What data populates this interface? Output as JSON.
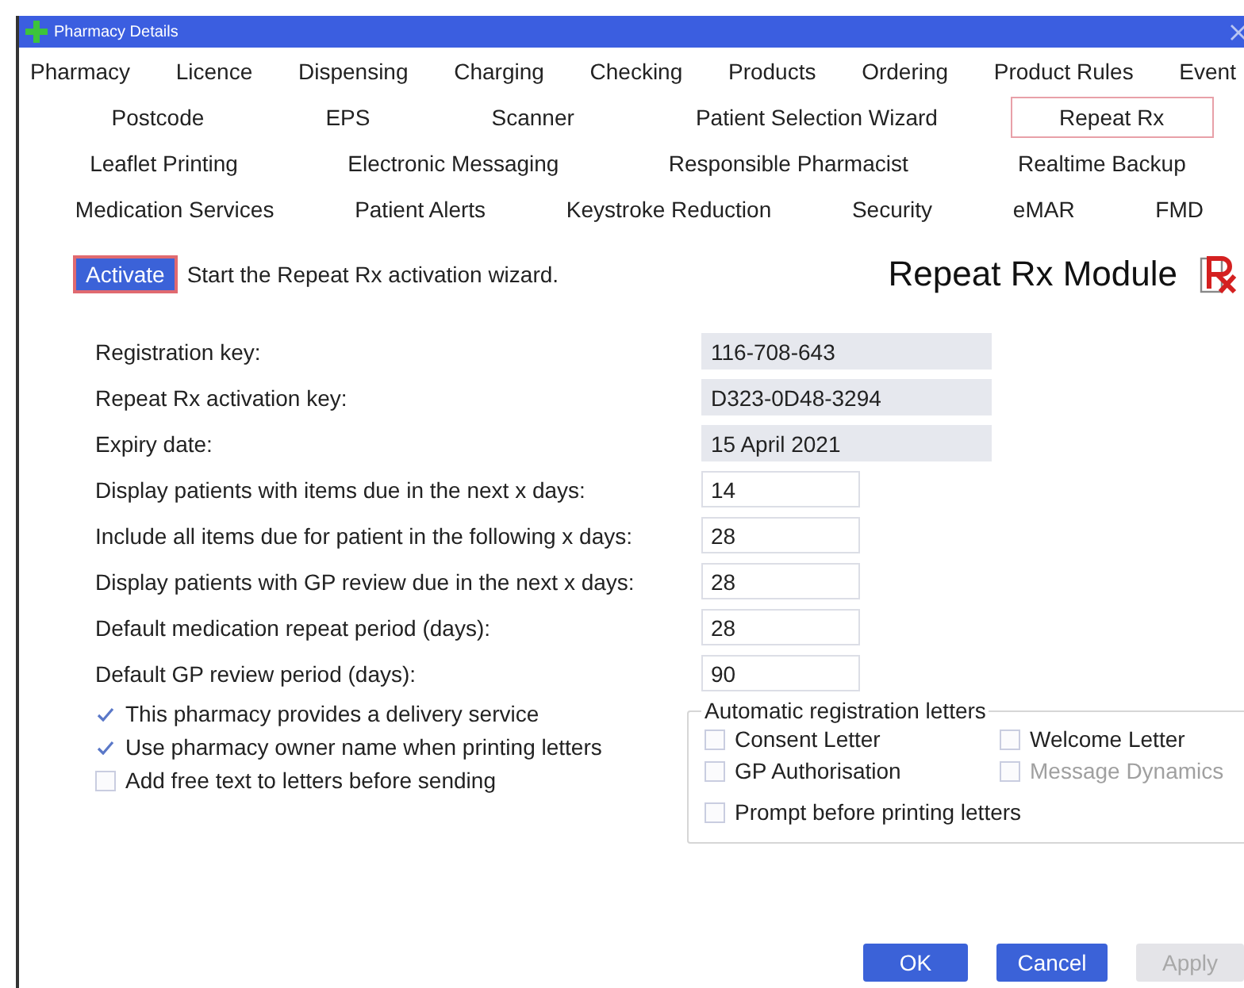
{
  "window": {
    "title": "Pharmacy Details"
  },
  "tab_rows": [
    [
      {
        "label": "Pharmacy",
        "selected": false
      },
      {
        "label": "Licence",
        "selected": false
      },
      {
        "label": "Dispensing",
        "selected": false
      },
      {
        "label": "Charging",
        "selected": false
      },
      {
        "label": "Checking",
        "selected": false
      },
      {
        "label": "Products",
        "selected": false
      },
      {
        "label": "Ordering",
        "selected": false
      },
      {
        "label": "Product Rules",
        "selected": false
      },
      {
        "label": "Event",
        "selected": false
      }
    ],
    [
      {
        "label": "Postcode",
        "selected": false
      },
      {
        "label": "EPS",
        "selected": false
      },
      {
        "label": "Scanner",
        "selected": false
      },
      {
        "label": "Patient Selection Wizard",
        "selected": false
      },
      {
        "label": "Repeat Rx",
        "selected": true
      }
    ],
    [
      {
        "label": "Leaflet Printing",
        "selected": false
      },
      {
        "label": "Electronic Messaging",
        "selected": false
      },
      {
        "label": "Responsible Pharmacist",
        "selected": false
      },
      {
        "label": "Realtime Backup",
        "selected": false
      }
    ],
    [
      {
        "label": "Medication Services",
        "selected": false
      },
      {
        "label": "Patient Alerts",
        "selected": false
      },
      {
        "label": "Keystroke Reduction",
        "selected": false
      },
      {
        "label": "Security",
        "selected": false
      },
      {
        "label": "eMAR",
        "selected": false
      },
      {
        "label": "FMD",
        "selected": false
      }
    ]
  ],
  "activate": {
    "button": "Activate",
    "description": "Start the Repeat Rx activation wizard."
  },
  "module_title": "Repeat Rx Module",
  "fields": [
    {
      "label": "Registration key:",
      "value": "116-708-643",
      "readonly": true
    },
    {
      "label": "Repeat Rx activation key:",
      "value": "D323-0D48-3294",
      "readonly": true
    },
    {
      "label": "Expiry date:",
      "value": "15 April 2021",
      "readonly": true
    },
    {
      "label": "Display patients with items due in the next x days:",
      "value": "14",
      "readonly": false
    },
    {
      "label": "Include all items due for patient in the following x days:",
      "value": "28",
      "readonly": false
    },
    {
      "label": "Display patients with GP review due in the next x days:",
      "value": "28",
      "readonly": false
    },
    {
      "label": "Default medication repeat period (days):",
      "value": "28",
      "readonly": false
    },
    {
      "label": "Default GP review period (days):",
      "value": "90",
      "readonly": false
    }
  ],
  "options": [
    {
      "label": "This pharmacy provides a delivery service",
      "checked": true
    },
    {
      "label": "Use pharmacy owner name when printing letters",
      "checked": true
    },
    {
      "label": "Add free text to letters before sending",
      "checked": false
    }
  ],
  "letters_group": {
    "title": "Automatic registration letters",
    "items": [
      {
        "label": "Consent Letter",
        "checked": false,
        "disabled": false
      },
      {
        "label": "Welcome Letter",
        "checked": false,
        "disabled": false
      },
      {
        "label": "GP Authorisation",
        "checked": false,
        "disabled": false
      },
      {
        "label": "Message Dynamics",
        "checked": false,
        "disabled": true
      },
      {
        "label": "Prompt before printing letters",
        "checked": false,
        "disabled": false
      }
    ]
  },
  "buttons": [
    {
      "label": "OK",
      "disabled": false
    },
    {
      "label": "Cancel",
      "disabled": false
    },
    {
      "label": "Apply",
      "disabled": true
    }
  ]
}
